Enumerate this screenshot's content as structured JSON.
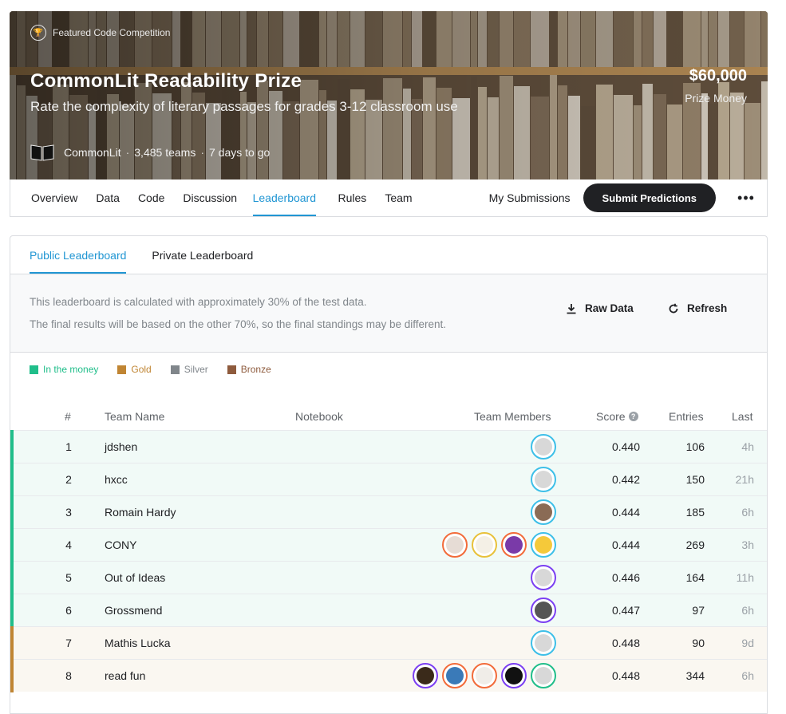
{
  "hero": {
    "featured_label": "Featured Code Competition",
    "title": "CommonLit Readability Prize",
    "subtitle": "Rate the complexity of literary passages for grades 3-12 classroom use",
    "host": "CommonLit",
    "teams": "3,485 teams",
    "deadline": "7 days to go",
    "prize_amount": "$60,000",
    "prize_label": "Prize Money"
  },
  "nav": {
    "tabs": [
      "Overview",
      "Data",
      "Code",
      "Discussion",
      "Leaderboard",
      "Rules",
      "Team"
    ],
    "active_tab": "Leaderboard",
    "my_submissions": "My Submissions",
    "submit_label": "Submit Predictions",
    "more": "•••"
  },
  "leaderboard": {
    "tabs": [
      "Public Leaderboard",
      "Private Leaderboard"
    ],
    "active_tab": "Public Leaderboard",
    "info_line1": "This leaderboard is calculated with approximately 30% of the test data.",
    "info_line2": "The final results will be based on the other 70%, so the final standings may be different.",
    "raw_data": "Raw Data",
    "refresh": "Refresh",
    "legend": [
      {
        "label": "In the money",
        "color": "#20be8a"
      },
      {
        "label": "Gold",
        "color": "#c08533"
      },
      {
        "label": "Silver",
        "color": "#80868b"
      },
      {
        "label": "Bronze",
        "color": "#8e5b3d"
      }
    ],
    "columns": {
      "rank": "#",
      "team": "Team Name",
      "notebook": "Notebook",
      "members": "Team Members",
      "score": "Score",
      "entries": "Entries",
      "last": "Last"
    },
    "rows": [
      {
        "rank": "1",
        "team": "jdshen",
        "score": "0.440",
        "entries": "106",
        "last": "4h",
        "tier": "money",
        "members": [
          {
            "ring": "#3dbfe8",
            "face": "#d8d8d8"
          }
        ]
      },
      {
        "rank": "2",
        "team": "hxcc",
        "score": "0.442",
        "entries": "150",
        "last": "21h",
        "tier": "money",
        "members": [
          {
            "ring": "#3dbfe8",
            "face": "#d8d8d8"
          }
        ]
      },
      {
        "rank": "3",
        "team": "Romain Hardy",
        "score": "0.444",
        "entries": "185",
        "last": "6h",
        "tier": "money",
        "members": [
          {
            "ring": "#3dbfe8",
            "face": "#8a6b55"
          }
        ]
      },
      {
        "rank": "4",
        "team": "CONY",
        "score": "0.444",
        "entries": "269",
        "last": "3h",
        "tier": "money",
        "members": [
          {
            "ring": "#f26b3a",
            "face": "#e6dcd5"
          },
          {
            "ring": "#e8c13a",
            "face": "#f4f0e6"
          },
          {
            "ring": "#f26b3a",
            "face": "#7a3aa8"
          },
          {
            "ring": "#3dbfe8",
            "face": "#f5c93a"
          }
        ]
      },
      {
        "rank": "5",
        "team": "Out of Ideas",
        "score": "0.446",
        "entries": "164",
        "last": "11h",
        "tier": "money",
        "members": [
          {
            "ring": "#7b3ff2",
            "face": "#d8d8d8"
          }
        ]
      },
      {
        "rank": "6",
        "team": "Grossmend",
        "score": "0.447",
        "entries": "97",
        "last": "6h",
        "tier": "money",
        "members": [
          {
            "ring": "#7b3ff2",
            "face": "#555555"
          }
        ]
      },
      {
        "rank": "7",
        "team": "Mathis Lucka",
        "score": "0.448",
        "entries": "90",
        "last": "9d",
        "tier": "gold",
        "members": [
          {
            "ring": "#3dbfe8",
            "face": "#d8d8d8"
          }
        ]
      },
      {
        "rank": "8",
        "team": "read fun",
        "score": "0.448",
        "entries": "344",
        "last": "6h",
        "tier": "gold",
        "members": [
          {
            "ring": "#7b3ff2",
            "face": "#3a2a1a"
          },
          {
            "ring": "#f26b3a",
            "face": "#3a7ab8"
          },
          {
            "ring": "#f26b3a",
            "face": "#f0ede8"
          },
          {
            "ring": "#7b3ff2",
            "face": "#111111"
          },
          {
            "ring": "#20be8a",
            "face": "#d8d8d8"
          }
        ]
      }
    ]
  }
}
